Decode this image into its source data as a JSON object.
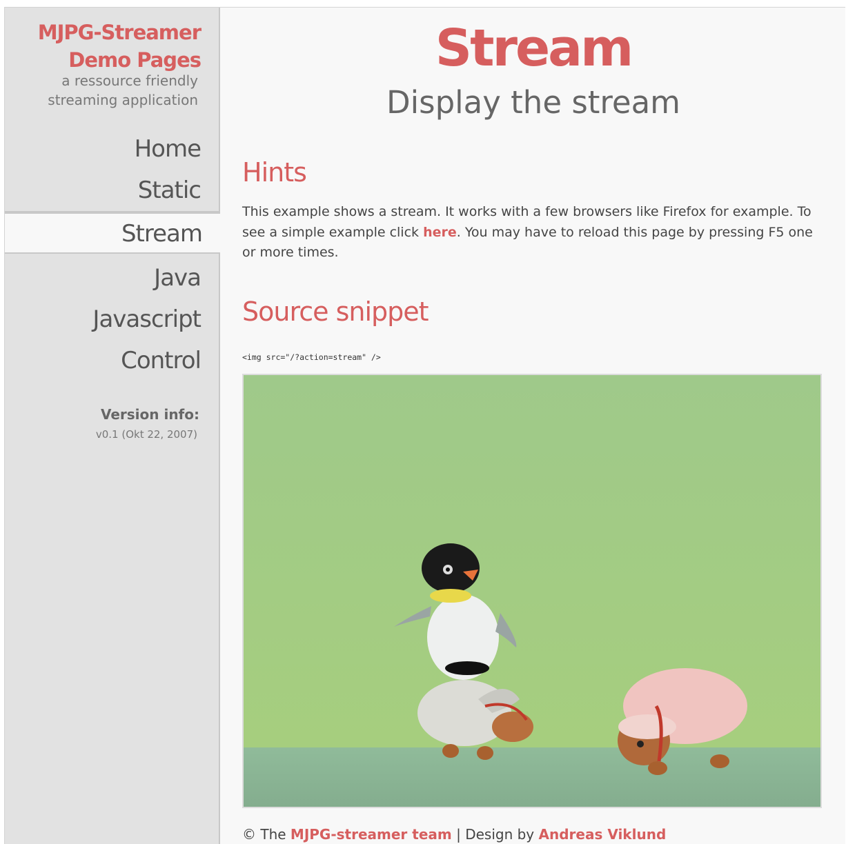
{
  "sidebar": {
    "title_line1": "MJPG-Streamer",
    "title_line2": "Demo Pages",
    "tagline_line1": "a ressource friendly",
    "tagline_line2": "streaming application",
    "nav": [
      {
        "label": "Home"
      },
      {
        "label": "Static"
      },
      {
        "label": "Stream",
        "active": true
      },
      {
        "label": "Java"
      },
      {
        "label": "Javascript"
      },
      {
        "label": "Control"
      }
    ],
    "version_title": "Version info:",
    "version_text": "v0.1 (Okt 22, 2007)"
  },
  "main": {
    "title": "Stream",
    "subtitle": "Display the stream",
    "hints_heading": "Hints",
    "hints_text_before": "This example shows a stream. It works with a few browsers like Firefox for example. To see a simple example click ",
    "hints_link": "here",
    "hints_text_after": ". You may have to reload this page by pressing F5 one or more times.",
    "source_heading": "Source snippet",
    "code": "<img src=\"/?action=stream\" />"
  },
  "footer": {
    "prefix": "© The ",
    "team_link": "MJPG-streamer team",
    "separator": " | Design by ",
    "designer_link": "Andreas Viklund"
  },
  "colors": {
    "accent": "#d65e5e",
    "sidebar_bg": "#e2e2e2",
    "content_bg": "#f8f8f8",
    "stream_wall": "#9ec784",
    "stream_floor": "#8bb59a"
  }
}
